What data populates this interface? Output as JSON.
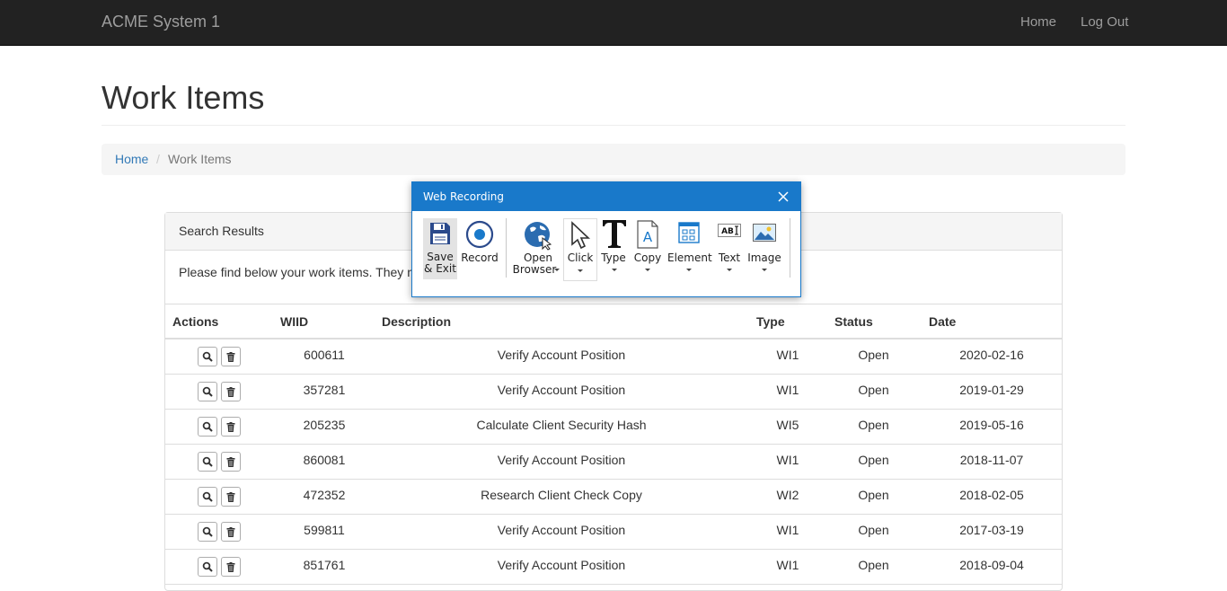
{
  "navbar": {
    "brand": "ACME System 1",
    "links": [
      {
        "label": "Home"
      },
      {
        "label": "Log Out"
      }
    ]
  },
  "page": {
    "title": "Work Items"
  },
  "breadcrumb": {
    "home": "Home",
    "separator": "/",
    "current": "Work Items"
  },
  "panel": {
    "title": "Search Results",
    "body_text": "Please find below your work items. They n"
  },
  "table": {
    "headers": [
      "Actions",
      "WIID",
      "Description",
      "Type",
      "Status",
      "Date"
    ],
    "rows": [
      {
        "wiid": "600611",
        "description": "Verify Account Position",
        "type": "WI1",
        "status": "Open",
        "date": "2020-02-16"
      },
      {
        "wiid": "357281",
        "description": "Verify Account Position",
        "type": "WI1",
        "status": "Open",
        "date": "2019-01-29"
      },
      {
        "wiid": "205235",
        "description": "Calculate Client Security Hash",
        "type": "WI5",
        "status": "Open",
        "date": "2019-05-16"
      },
      {
        "wiid": "860081",
        "description": "Verify Account Position",
        "type": "WI1",
        "status": "Open",
        "date": "2018-11-07"
      },
      {
        "wiid": "472352",
        "description": "Research Client Check Copy",
        "type": "WI2",
        "status": "Open",
        "date": "2018-02-05"
      },
      {
        "wiid": "599811",
        "description": "Verify Account Position",
        "type": "WI1",
        "status": "Open",
        "date": "2017-03-19"
      },
      {
        "wiid": "851761",
        "description": "Verify Account Position",
        "type": "WI1",
        "status": "Open",
        "date": "2018-09-04"
      }
    ],
    "row_action_icons": [
      "search-icon",
      "trash-icon"
    ]
  },
  "recorder": {
    "title": "Web Recording",
    "tools": {
      "save_exit_1": "Save",
      "save_exit_2": "& Exit",
      "record": "Record",
      "open_browser_1": "Open",
      "open_browser_2": "Browser",
      "click": "Click",
      "type": "Type",
      "copy": "Copy",
      "element": "Element",
      "text": "Text",
      "image": "Image"
    },
    "icons": [
      "floppy-icon",
      "record-icon",
      "globe-icon",
      "cursor-icon",
      "big-t-icon",
      "document-a-icon",
      "element-grid-icon",
      "abi-text-icon",
      "picture-icon",
      "close-icon"
    ]
  },
  "colors": {
    "navbar_bg": "#222222",
    "nav_text": "#9d9d9d",
    "link": "#337ab7",
    "dialog_accent": "#1979ca"
  }
}
